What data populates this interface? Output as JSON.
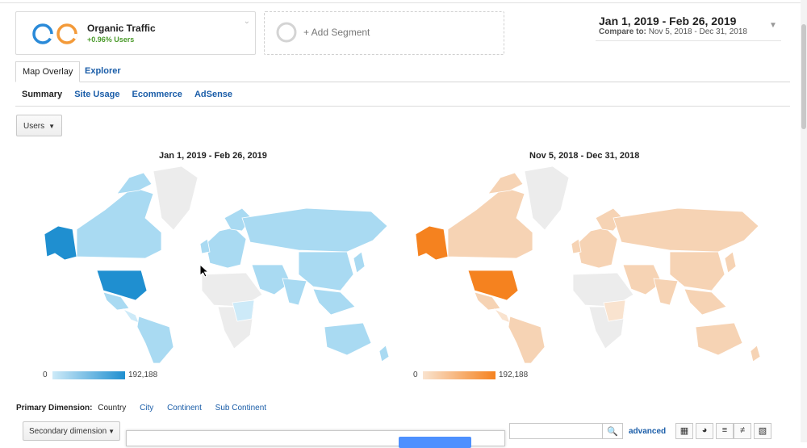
{
  "segments": {
    "organic": {
      "title": "Organic Traffic",
      "subtitle": "+0.96% Users"
    },
    "add_label": "+ Add Segment"
  },
  "date_range": {
    "primary": "Jan 1, 2019 - Feb 26, 2019",
    "compare_label": "Compare to:",
    "compare": "Nov 5, 2018 - Dec 31, 2018"
  },
  "tabs": [
    {
      "label": "Map Overlay",
      "active": true
    },
    {
      "label": "Explorer",
      "active": false
    }
  ],
  "subnav": [
    {
      "label": "Summary",
      "active": true
    },
    {
      "label": "Site Usage",
      "active": false
    },
    {
      "label": "Ecommerce",
      "active": false
    },
    {
      "label": "AdSense",
      "active": false
    }
  ],
  "metric_dropdown": "Users",
  "maps": [
    {
      "title": "Jan 1, 2019 - Feb 26, 2019",
      "legend_min": "0",
      "legend_max": "192,188",
      "colors": {
        "high": "#1f8fd0",
        "light": "#a9daf2",
        "pale": "#cdeaf8",
        "none": "#ececec"
      }
    },
    {
      "title": "Nov 5, 2018 - Dec 31, 2018",
      "legend_min": "0",
      "legend_max": "192,188",
      "colors": {
        "high": "#f5821f",
        "light": "#f6d3b4",
        "pale": "#f9e3cf",
        "none": "#ececec"
      }
    }
  ],
  "primary_dimension": {
    "label": "Primary Dimension:",
    "current": "Country",
    "options": [
      "City",
      "Continent",
      "Sub Continent"
    ]
  },
  "secondary_dimension": "Secondary dimension",
  "search": {
    "placeholder": "",
    "button_icon": "search-icon"
  },
  "advanced_label": "advanced",
  "view_buttons": [
    "grid-view-icon",
    "pie-view-icon",
    "performance-view-icon",
    "comparison-view-icon",
    "pivot-view-icon"
  ]
}
